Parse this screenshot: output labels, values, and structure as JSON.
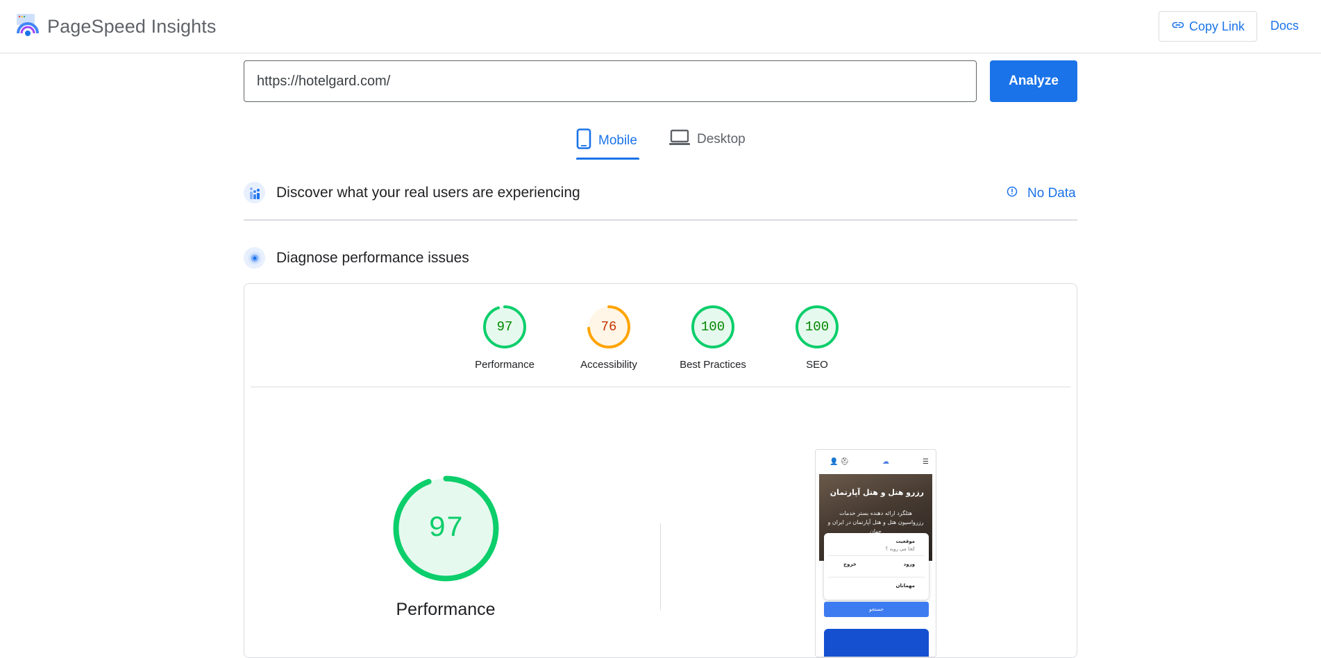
{
  "header": {
    "app_title": "PageSpeed Insights",
    "copy_link_label": "Copy Link",
    "docs_label": "Docs"
  },
  "url_bar": {
    "value": "https://hotelgard.com/",
    "analyze_label": "Analyze"
  },
  "tabs": {
    "mobile": "Mobile",
    "desktop": "Desktop",
    "active": "Mobile"
  },
  "field_data": {
    "title": "Discover what your real users are experiencing",
    "status": "No Data"
  },
  "lab_data": {
    "title": "Diagnose performance issues",
    "scores": [
      {
        "label": "Performance",
        "value": 97,
        "rating": "pass"
      },
      {
        "label": "Accessibility",
        "value": 76,
        "rating": "average"
      },
      {
        "label": "Best Practices",
        "value": 100,
        "rating": "pass"
      },
      {
        "label": "SEO",
        "value": 100,
        "rating": "pass"
      }
    ],
    "main_score": {
      "label": "Performance",
      "value": 97
    }
  },
  "colors": {
    "pass": "#0cce6b",
    "pass_text": "#008800",
    "pass_fill": "#e6f9ee",
    "average": "#ffa400",
    "average_text": "#c33300",
    "average_fill": "#fff6e8",
    "accent": "#1a73e8"
  },
  "thumbnail": {
    "hero_title": "رزرو هتل و هتل آپارتمان",
    "hero_subtitle": "هتلگرد ارائه دهنده بستر خدمات رزرواسیون هتل و هتل آپارتمان در ایران و جهان",
    "row1_label": "موقعیت",
    "row1_sub": "کجا می روید ؟",
    "row2_in": "ورود",
    "row2_out": "خروج",
    "row3_label": "مهمانان",
    "search_label": "جستجو"
  }
}
